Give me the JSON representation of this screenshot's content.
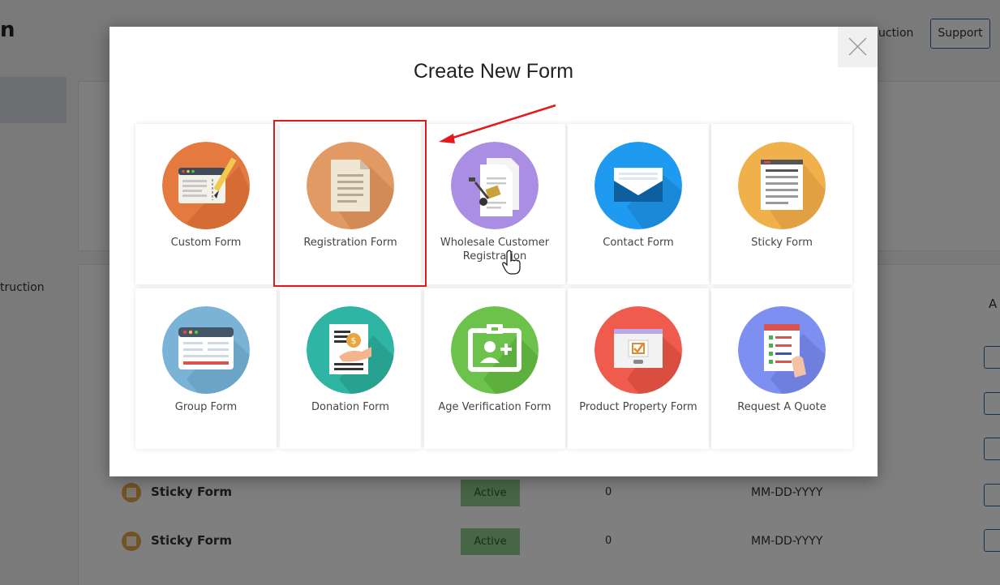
{
  "background": {
    "app_title": "n",
    "header_link": "uction",
    "support_button": "Support",
    "sidebar_text": "truction",
    "column_head": "A",
    "rows": [
      {
        "name": "Sticky Form",
        "status": "Active",
        "count": "0",
        "date": "MM-DD-YYYY"
      },
      {
        "name": "Sticky Form",
        "status": "Active",
        "count": "0",
        "date": "MM-DD-YYYY"
      }
    ]
  },
  "modal": {
    "title": "Create New Form",
    "close_icon": "close-icon",
    "highlight_color": "#e21a1a",
    "forms": [
      {
        "label": "Custom Form",
        "icon": "custom-form-icon",
        "color": "#e47a3f"
      },
      {
        "label": "Registration Form",
        "icon": "registration-form-icon",
        "color": "#e19a64"
      },
      {
        "label": "Wholesale Customer Registration",
        "icon": "wholesale-registration-icon",
        "color": "#a98ee4"
      },
      {
        "label": "Contact Form",
        "icon": "envelope-icon",
        "color": "#1e9bf0"
      },
      {
        "label": "Sticky Form",
        "icon": "sticky-form-icon",
        "color": "#f0b14c"
      },
      {
        "label": "Group Form",
        "icon": "group-form-icon",
        "color": "#7ab3d6"
      },
      {
        "label": "Donation Form",
        "icon": "donation-icon",
        "color": "#2fb5a4"
      },
      {
        "label": "Age Verification Form",
        "icon": "id-card-icon",
        "color": "#6cc24a"
      },
      {
        "label": "Product Property Form",
        "icon": "product-property-icon",
        "color": "#ef5b4c"
      },
      {
        "label": "Request A Quote",
        "icon": "quote-checklist-icon",
        "color": "#7d8ff0"
      }
    ]
  }
}
